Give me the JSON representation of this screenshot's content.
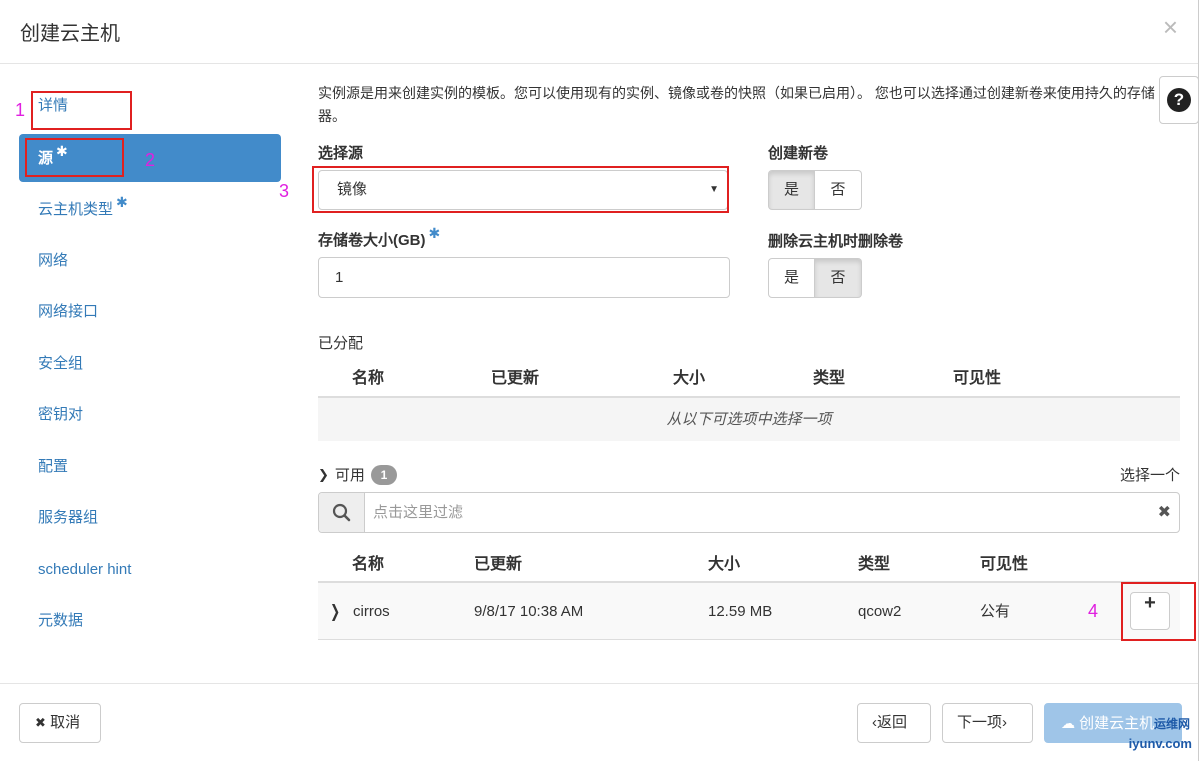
{
  "dialog": {
    "title": "创建云主机",
    "close_symbol": "×"
  },
  "sidebar": {
    "items": [
      {
        "label": "详情",
        "required": false
      },
      {
        "label": "源",
        "required": true
      },
      {
        "label": "云主机类型",
        "required": true
      },
      {
        "label": "网络",
        "required": false
      },
      {
        "label": "网络接口",
        "required": false
      },
      {
        "label": "安全组",
        "required": false
      },
      {
        "label": "密钥对",
        "required": false
      },
      {
        "label": "配置",
        "required": false
      },
      {
        "label": "服务器组",
        "required": false
      },
      {
        "label": "scheduler hint",
        "required": false
      },
      {
        "label": "元数据",
        "required": false
      }
    ],
    "active": "源",
    "required_mark": "✱"
  },
  "intro": "实例源是用来创建实例的模板。您可以使用现有的实例、镜像或卷的快照（如果已启用）。 您也可以选择通过创建新卷来使用持久的存储器。",
  "help": {
    "symbol": "?"
  },
  "form": {
    "source_label": "选择源",
    "source_value": "镜像",
    "volume_size_label": "存储卷大小(GB)",
    "volume_size_value": "1",
    "create_volume_label": "创建新卷",
    "delete_volume_label": "删除云主机时删除卷",
    "yes": "是",
    "no": "否",
    "create_volume_selected": "是",
    "delete_volume_selected": "否"
  },
  "allocated": {
    "title": "已分配",
    "columns": [
      "名称",
      "已更新",
      "大小",
      "类型",
      "可见性"
    ],
    "empty_text": "从以下可选项中选择一项"
  },
  "available": {
    "title": "可用",
    "count": "1",
    "select_hint": "选择一个",
    "filter_placeholder": "点击这里过滤",
    "clear_symbol": "✖",
    "columns": [
      "名称",
      "已更新",
      "大小",
      "类型",
      "可见性"
    ],
    "rows": [
      {
        "name": "cirros",
        "updated": "9/8/17 10:38 AM",
        "size": "12.59 MB",
        "type": "qcow2",
        "visibility": "公有"
      }
    ],
    "add_symbol": "+"
  },
  "annotations": [
    "1",
    "2",
    "3",
    "4"
  ],
  "footer": {
    "cancel": "取消",
    "back": "‹返回",
    "next": "下一项›",
    "create": "创建云主机"
  },
  "watermark": {
    "text": "运维网",
    "sub": "iyunv.com"
  },
  "colors": {
    "accent": "#428bca",
    "annotation_box": "#e02020",
    "annotation_num": "#e020e0"
  }
}
